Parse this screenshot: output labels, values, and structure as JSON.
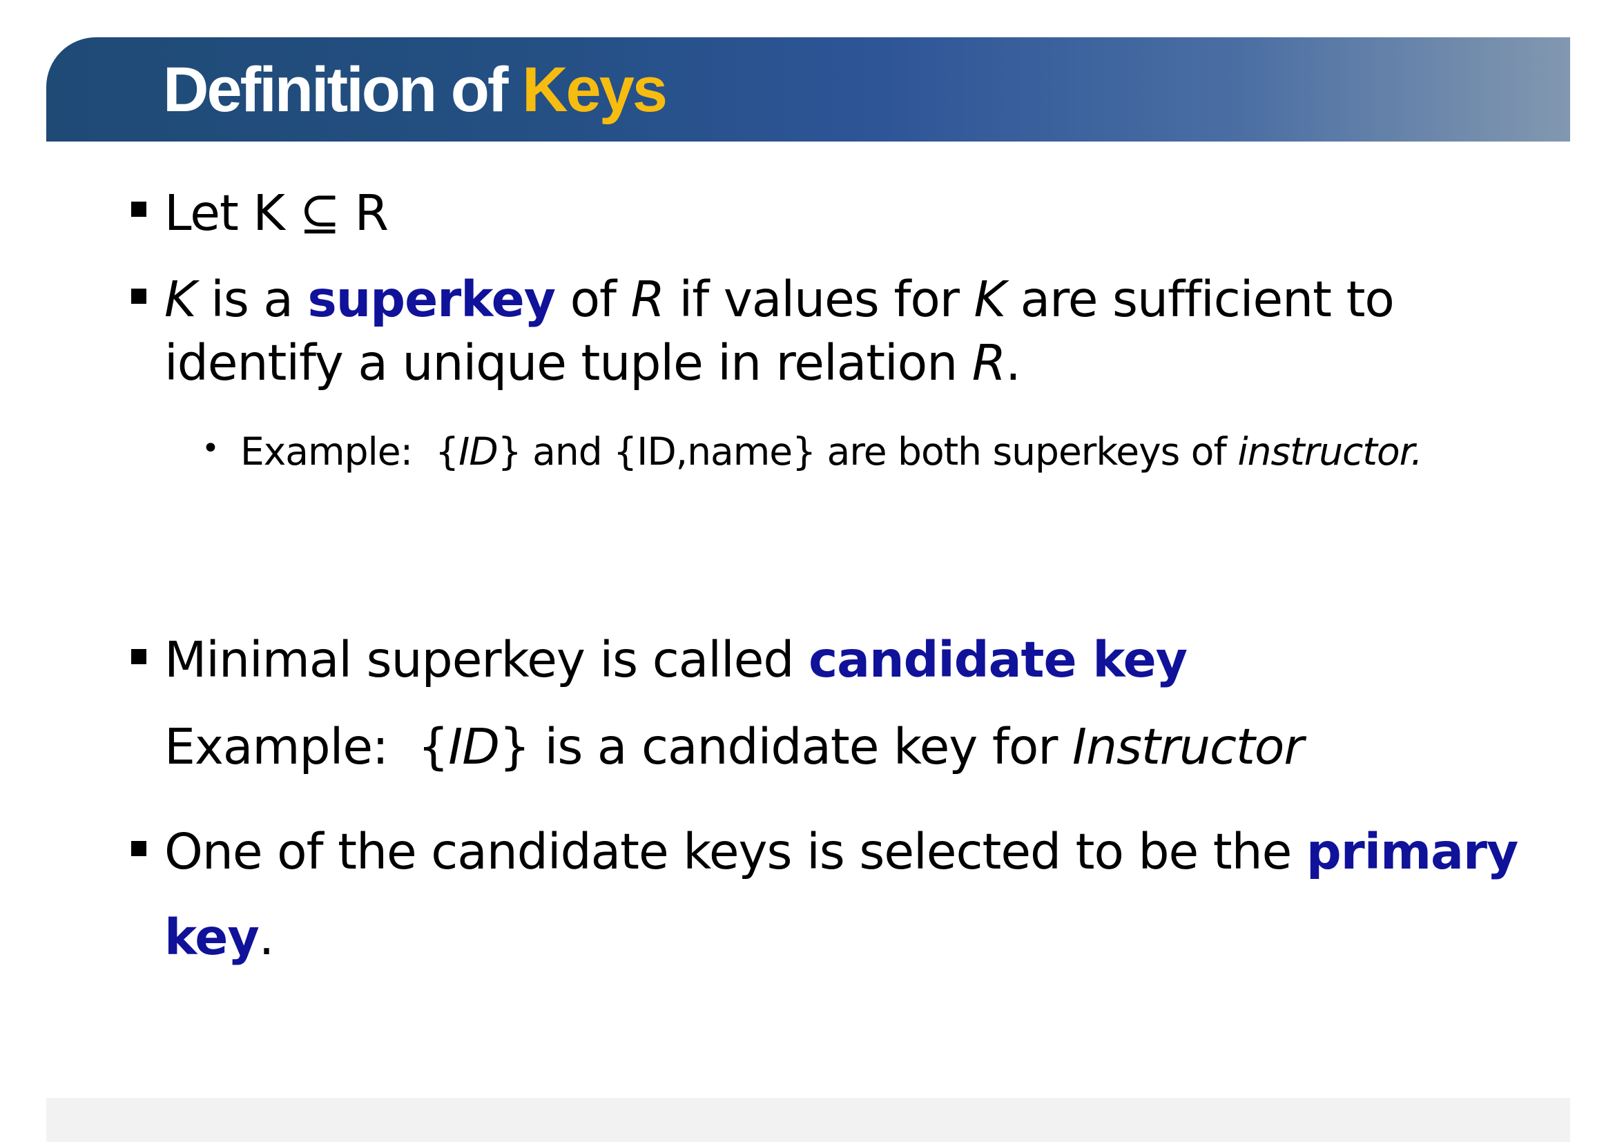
{
  "title": {
    "prefix": "Definition of ",
    "highlight": "Keys"
  },
  "colors": {
    "title_accent": "#f7bc10",
    "term": "#10129a",
    "title_bar_start": "#1f4a76",
    "title_bar_end": "#8298b0"
  },
  "bullets": {
    "let": {
      "a": "Let K",
      "symbol": "⊆",
      "b": "R"
    },
    "superkey": {
      "k1": "K",
      "t1": " is a ",
      "term": "superkey",
      "t2": " of ",
      "r1": "R",
      "t3": " if values for ",
      "k2": "K",
      "t4": " are sufficient to",
      "line2": "identify a unique tuple in relation ",
      "r2": "R",
      "end": "."
    },
    "superkey_example": {
      "prefix": "Example:  {",
      "id": "ID",
      "middle": "} and {ID,name} are both superkeys of ",
      "relation": "instructor."
    },
    "candidate": {
      "text": "Minimal superkey is called ",
      "term": "candidate key"
    },
    "candidate_example": {
      "prefix": "Example:  {",
      "id": "ID",
      "middle": "} is a candidate key for ",
      "relation": "Instructor"
    },
    "primary": {
      "text": "One of the candidate keys is selected to be the ",
      "term_a": "primary",
      "term_b": "key",
      "end": "."
    }
  }
}
